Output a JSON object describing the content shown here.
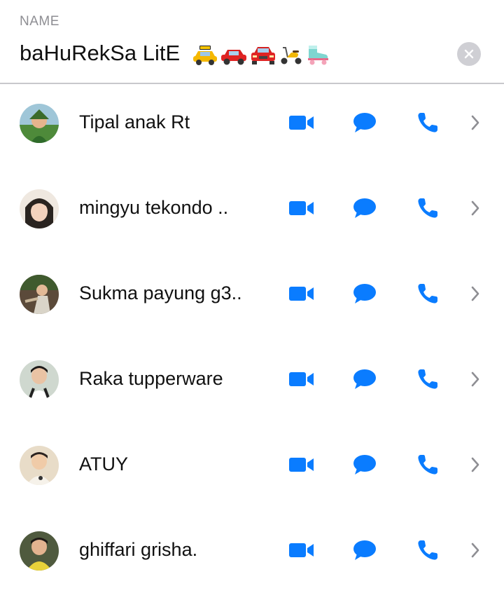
{
  "header": {
    "name_label": "NAME",
    "name_value": "baHuRekSa LitE",
    "emoji_icons": [
      "taxi-emoji-icon",
      "car-emoji-icon",
      "car-front-emoji-icon",
      "scooter-emoji-icon",
      "roller-skate-emoji-icon"
    ]
  },
  "contacts": [
    {
      "name": "Tipal anak Rt"
    },
    {
      "name": "mingyu tekondo .."
    },
    {
      "name": "Sukma payung g3.."
    },
    {
      "name": "Raka tupperware"
    },
    {
      "name": "ATUY"
    },
    {
      "name": "ghiffari grisha."
    }
  ],
  "colors": {
    "accent": "#0a7cff",
    "chevron": "#8e8e93",
    "divider": "#c8c8cc",
    "clear_button": "#cfcfd4"
  },
  "icons": {
    "video": "video-camera-icon",
    "message": "chat-bubble-icon",
    "call": "phone-icon",
    "chevron": "chevron-right-icon",
    "clear": "close-icon"
  }
}
